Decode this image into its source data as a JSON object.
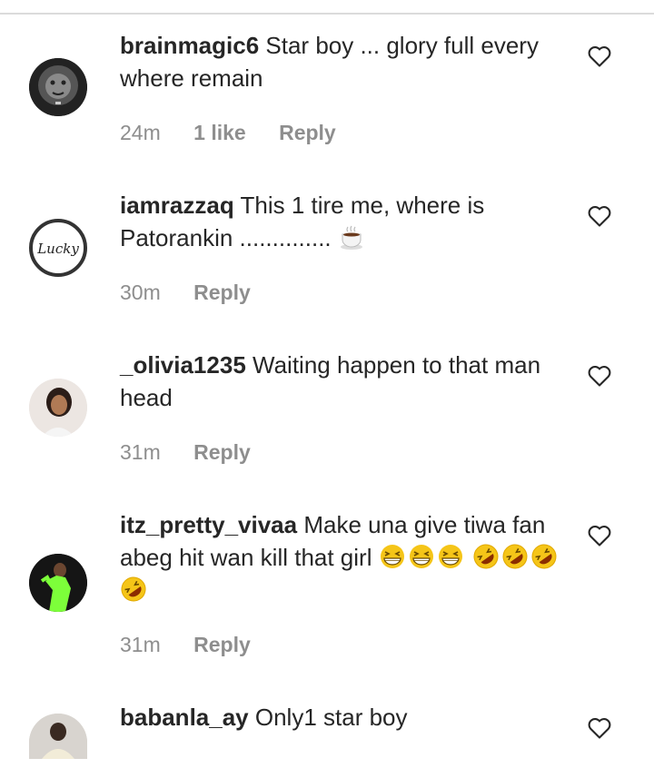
{
  "comments": [
    {
      "username": "brainmagic6",
      "text": "Star boy ... glory full every where remain",
      "time": "24m",
      "likes": "1 like",
      "reply": "Reply",
      "avatar": "lion-avatar"
    },
    {
      "username": "iamrazzaq",
      "text": "This 1 tire me, where is Patorankin ..............",
      "time": "30m",
      "reply": "Reply",
      "avatar": "lucky-logo-avatar",
      "avatar_text": "Lucky"
    },
    {
      "username": "_olivia1235",
      "text": "Waiting happen to that man head",
      "time": "31m",
      "reply": "Reply",
      "avatar": "woman-avatar"
    },
    {
      "username": "itz_pretty_vivaa",
      "text": "Make una give tiwa fan abeg hit wan kill that girl",
      "time": "31m",
      "reply": "Reply",
      "avatar": "woman-green-dress-avatar"
    },
    {
      "username": "babanla_ay",
      "text": "Only1 star boy",
      "avatar": "person-avatar"
    }
  ],
  "colors": {
    "text": "#262626",
    "meta": "#8e8e8e",
    "divider": "#dbdbdb",
    "emoji": "#f5c518"
  }
}
